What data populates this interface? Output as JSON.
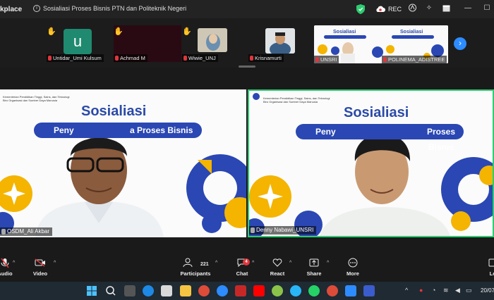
{
  "titlebar": {
    "app_name": "kplace",
    "meeting_title": "Sosialiasi Proses Bisnis PTN dan Politeknik Negeri",
    "rec_label": "REC"
  },
  "participants_strip": [
    {
      "name": "Untidar_Umi Kulsum",
      "avatar_letter": "u"
    },
    {
      "name": "Achmad M"
    },
    {
      "name": "Wiwie_UNJ"
    },
    {
      "name": "Krisnamurti"
    },
    {
      "name": "UNSRI"
    },
    {
      "name": "POLINEMA_ADISTREE"
    }
  ],
  "slide": {
    "org_line1": "Kementerian Pendidikan Tinggi, Sains, dan Teknologi",
    "org_line2": "Biro Organisasi dan Sumber Daya Manusia",
    "title": "Sosialiasi",
    "subtitle": "Penyusunan Proses Bisnis",
    "pill_visible_left": "Peny",
    "pill_visible_right": "a Proses Bisnis",
    "pill_visible_right2": "Proses Bisnis"
  },
  "main_videos": {
    "left_name": "OSDM_Ali Akbar",
    "right_name": "Denny Nabawi_UNSRI"
  },
  "toolbar": {
    "audio_label": "Audio",
    "video_label": "Video",
    "participants_label": "Participants",
    "participants_count": "221",
    "chat_label": "Chat",
    "chat_badge": "4",
    "react_label": "React",
    "share_label": "Share",
    "more_label": "More",
    "leave_label": "Le"
  },
  "taskbar": {
    "clock_date": "20/07"
  },
  "colors": {
    "brand_blue": "#2a47b3",
    "accent_yellow": "#f4b400",
    "active_speaker": "#2ecc71",
    "zoom_blue": "#2d8cff"
  }
}
